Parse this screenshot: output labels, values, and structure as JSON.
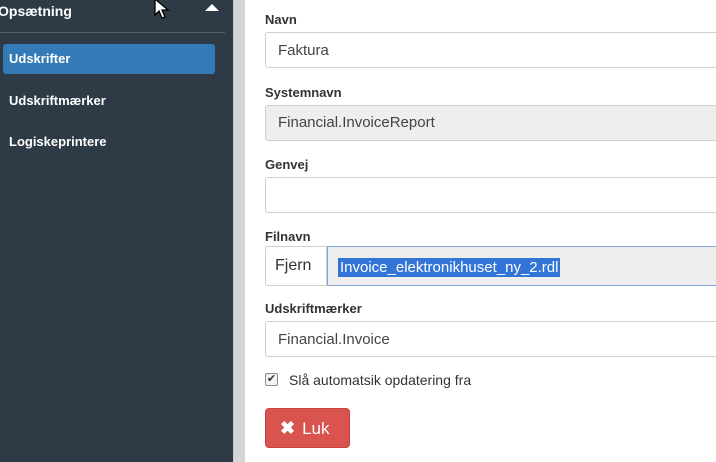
{
  "sidebar": {
    "header": "Opsætning",
    "items": [
      {
        "label": "Udskrifter",
        "active": true
      },
      {
        "label": "Udskriftmærker",
        "active": false
      },
      {
        "label": "Logiskeprintere",
        "active": false
      }
    ]
  },
  "form": {
    "name": {
      "label": "Navn",
      "value": "Faktura"
    },
    "system_name": {
      "label": "Systemnavn",
      "value": "Financial.InvoiceReport"
    },
    "shortcut": {
      "label": "Genvej",
      "value": ""
    },
    "file_name": {
      "label": "Filnavn",
      "remove_label": "Fjern",
      "value": "Invoice_elektronikhuset_ny_2.rdl"
    },
    "print_tags": {
      "label": "Udskriftmærker",
      "value": "Financial.Invoice"
    },
    "auto_update": {
      "label": "Slå automatsik opdatering fra",
      "checked": true
    },
    "close_label": "Luk"
  },
  "colors": {
    "sidebar_bg": "#2e3b46",
    "active_item": "#337ab7",
    "danger": "#d9534f",
    "selection": "#3375d6"
  },
  "icons": {
    "caret": "caret-up-icon",
    "close": "x-icon",
    "check": "check-icon",
    "cursor": "mouse-cursor-icon"
  }
}
